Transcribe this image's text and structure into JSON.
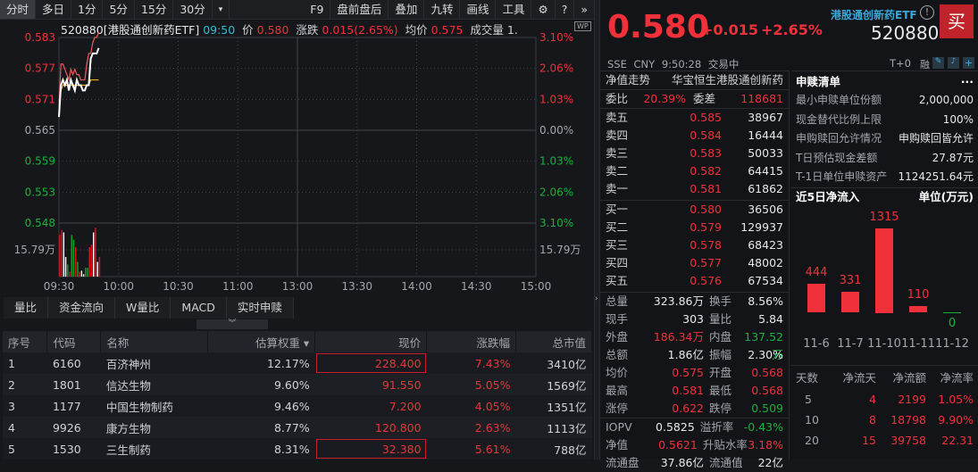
{
  "toolbar": {
    "tabs": [
      "分时",
      "多日",
      "1分",
      "5分",
      "15分",
      "30分"
    ],
    "right": [
      "F9",
      "盘前盘后",
      "叠加",
      "九转",
      "画线",
      "工具"
    ]
  },
  "chart_header": {
    "code_name": "520880[港股通创新药ETF]",
    "time": "09:50",
    "price_label": "价",
    "price": "0.580",
    "change_label": "涨跌",
    "change": "0.015(2.65%)",
    "avg_label": "均价",
    "avg": "0.575",
    "vol_label": "成交量",
    "vol": "1.",
    "wp": "WP"
  },
  "chart_data": {
    "type": "line",
    "title": "分时",
    "y_ticks_left": [
      "0.583",
      "0.577",
      "0.571",
      "0.565",
      "0.559",
      "0.553",
      "0.548"
    ],
    "y_ticks_right": [
      "3.10%",
      "2.06%",
      "1.03%",
      "0.00%",
      "1.03%",
      "2.06%",
      "3.10%"
    ],
    "ylim": [
      0.548,
      0.583
    ],
    "prev_close": 0.565,
    "x_ticks": [
      "09:30",
      "10:00",
      "10:30",
      "11:00",
      "13:00",
      "13:30",
      "14:00",
      "14:30",
      "15:00"
    ],
    "volume_tick": "15.79万",
    "series": [
      {
        "name": "price",
        "color": "#ffffff",
        "values": [
          0.568,
          0.574,
          0.575,
          0.574,
          0.575,
          0.573,
          0.575,
          0.574,
          0.573,
          0.575,
          0.574,
          0.574,
          0.573,
          0.573,
          0.574,
          0.574,
          0.579,
          0.58,
          0.58,
          0.58,
          0.581
        ]
      },
      {
        "name": "iopv",
        "color": "#f05a5a",
        "values": [
          0.57,
          0.578,
          0.578,
          0.577,
          0.576,
          0.575,
          0.577,
          0.576,
          0.577,
          0.576,
          0.576,
          0.575,
          0.575,
          0.575,
          0.578,
          0.58,
          0.58,
          0.582,
          0.583,
          0.583,
          0.584
        ]
      },
      {
        "name": "avg",
        "color": "#f0b020",
        "values": [
          0.571,
          0.573,
          0.574,
          0.574,
          0.574,
          0.574,
          0.574,
          0.574,
          0.574,
          0.574,
          0.574,
          0.574,
          0.574,
          0.574,
          0.574,
          0.574,
          0.575,
          0.575,
          0.575,
          0.575,
          0.575
        ]
      }
    ],
    "volume": [
      {
        "v": 0.85,
        "c": "r"
      },
      {
        "v": 0.95,
        "c": "r"
      },
      {
        "v": 0.9,
        "c": "w"
      },
      {
        "v": 0.4,
        "c": "w"
      },
      {
        "v": 0.25,
        "c": "g"
      },
      {
        "v": 0.1,
        "c": "r"
      },
      {
        "v": 0.85,
        "c": "g"
      },
      {
        "v": 0.75,
        "c": "g"
      },
      {
        "v": 0.6,
        "c": "r"
      },
      {
        "v": 0.3,
        "c": "g"
      },
      {
        "v": 0.1,
        "c": "r"
      },
      {
        "v": 0.12,
        "c": "w"
      },
      {
        "v": 0.05,
        "c": "w"
      },
      {
        "v": 0.18,
        "c": "g"
      },
      {
        "v": 0.18,
        "c": "g"
      },
      {
        "v": 0.6,
        "c": "r"
      },
      {
        "v": 0.65,
        "c": "r"
      },
      {
        "v": 0.9,
        "c": "w"
      },
      {
        "v": 1.0,
        "c": "r"
      },
      {
        "v": 0.3,
        "c": "w"
      },
      {
        "v": 0.4,
        "c": "r"
      }
    ]
  },
  "subtabs": [
    "量比",
    "资金流向",
    "W量比",
    "MACD",
    "实时申赎"
  ],
  "table": {
    "headers": [
      "序号",
      "代码",
      "名称",
      "估算权重 ▾",
      "现价",
      "涨跌幅",
      "总市值"
    ],
    "rows": [
      [
        "1",
        "6160",
        "百济神州",
        "12.17%",
        "228.400",
        "7.43%",
        "3410亿"
      ],
      [
        "2",
        "1801",
        "信达生物",
        "9.60%",
        "91.550",
        "5.05%",
        "1569亿"
      ],
      [
        "3",
        "1177",
        "中国生物制药",
        "9.46%",
        "7.200",
        "4.05%",
        "1351亿"
      ],
      [
        "4",
        "9926",
        "康方生物",
        "8.77%",
        "120.800",
        "2.63%",
        "1113亿"
      ],
      [
        "5",
        "1530",
        "三生制药",
        "8.31%",
        "32.380",
        "5.61%",
        "788亿"
      ]
    ]
  },
  "quote": {
    "price": "0.580",
    "change": "+0.015",
    "pct": "+2.65%",
    "name": "港股通创新药ETF",
    "code": "520880",
    "buy": "买",
    "exchange": "SSE",
    "currency": "CNY",
    "time": "9:50:28",
    "status": "交易中",
    "t0": "T+0",
    "rong": "融"
  },
  "nav": {
    "label": "净值走势",
    "fund": "华宝恒生港股通创新药"
  },
  "weibi": {
    "label": "委比",
    "value": "20.39%",
    "label2": "委差",
    "value2": "118681"
  },
  "asks": [
    [
      "卖五",
      "0.585",
      "38967"
    ],
    [
      "卖四",
      "0.584",
      "16444"
    ],
    [
      "卖三",
      "0.583",
      "50033"
    ],
    [
      "卖二",
      "0.582",
      "64415"
    ],
    [
      "卖一",
      "0.581",
      "61862"
    ]
  ],
  "bids": [
    [
      "买一",
      "0.580",
      "36506"
    ],
    [
      "买二",
      "0.579",
      "129937"
    ],
    [
      "买三",
      "0.578",
      "68423"
    ],
    [
      "买四",
      "0.577",
      "48002"
    ],
    [
      "买五",
      "0.576",
      "67534"
    ]
  ],
  "stats": [
    [
      "总量",
      "323.86万",
      "w",
      "换手",
      "8.56%",
      "w"
    ],
    [
      "现手",
      "303",
      "w",
      "量比",
      "5.84",
      "w"
    ],
    [
      "外盘",
      "186.34万",
      "r",
      "内盘",
      "137.52万",
      "g"
    ],
    [
      "总额",
      "1.86亿",
      "w",
      "振幅",
      "2.30%",
      "w"
    ],
    [
      "均价",
      "0.575",
      "r",
      "开盘",
      "0.568",
      "r"
    ],
    [
      "最高",
      "0.581",
      "r",
      "最低",
      "0.568",
      "r"
    ],
    [
      "涨停",
      "0.622",
      "r",
      "跌停",
      "0.509",
      "g"
    ]
  ],
  "stats2": [
    [
      "IOPV",
      "0.5825",
      "w",
      "溢折率",
      "-0.43%",
      "g"
    ],
    [
      "净值",
      "0.5621",
      "r",
      "升贴水率",
      "3.18%",
      "r"
    ],
    [
      "流通盘",
      "37.86亿",
      "w",
      "流通值",
      "22亿",
      "w"
    ]
  ],
  "sr": {
    "title": "申赎清单",
    "more": "···",
    "items": [
      [
        "最小申赎单位份额",
        "2,000,000"
      ],
      [
        "现金替代比例上限",
        "100%"
      ],
      [
        "申购赎回允许情况",
        "申购赎回皆允许"
      ],
      [
        "T日预估现金差额",
        "27.87元"
      ],
      [
        "T-1日单位申赎资产",
        "1124251.64元"
      ]
    ]
  },
  "flow": {
    "title": "近5日净流入",
    "unit": "单位(万元)",
    "bars": [
      {
        "date": "11-6",
        "value": 444
      },
      {
        "date": "11-7",
        "value": 331
      },
      {
        "date": "11-10",
        "value": 1315
      },
      {
        "date": "11-11",
        "value": 110
      },
      {
        "date": "11-12",
        "value": 0
      }
    ]
  },
  "flow_table": {
    "headers": [
      "天数",
      "净流天",
      "净流额",
      "净流率"
    ],
    "rows": [
      [
        "5",
        "4",
        "2199",
        "1.05%"
      ],
      [
        "10",
        "8",
        "18798",
        "9.90%"
      ],
      [
        "20",
        "15",
        "39758",
        "22.31"
      ]
    ]
  }
}
